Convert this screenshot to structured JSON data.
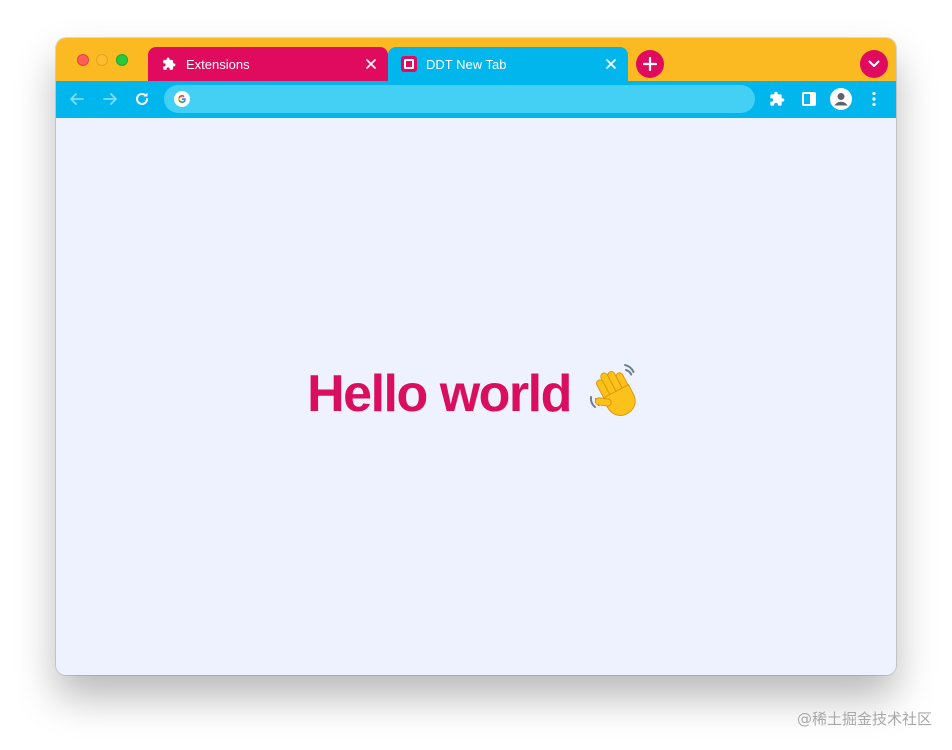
{
  "browser": {
    "tabs": [
      {
        "title": "Extensions",
        "icon": "puzzle-icon",
        "color": "#e00b5f"
      },
      {
        "title": "DDT New Tab",
        "icon": "ddt-favicon-icon",
        "color": "#00b6ec"
      }
    ],
    "tabstrip_color": "#fcba22",
    "toolbar_color": "#00b6ec",
    "omnibox": {
      "value": "",
      "placeholder": "",
      "engine_icon": "google-g-icon"
    }
  },
  "page": {
    "heading": "Hello world",
    "heading_color": "#da0e5f",
    "heading_emoji": "waving-hand-icon",
    "background": "#eef2fe"
  },
  "watermark": "@稀土掘金技术社区"
}
